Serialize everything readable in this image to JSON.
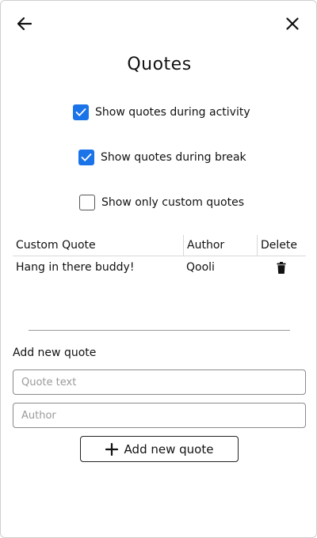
{
  "header": {
    "back_icon": "arrow-left-icon",
    "close_icon": "close-icon",
    "title": "Quotes"
  },
  "options": [
    {
      "label": "Show quotes during activity",
      "checked": true
    },
    {
      "label": "Show quotes during break",
      "checked": true
    },
    {
      "label": "Show only custom quotes",
      "checked": false
    }
  ],
  "table": {
    "columns": [
      "Custom Quote",
      "Author",
      "Delete"
    ],
    "rows": [
      {
        "quote": "Hang in there buddy!",
        "author": "Qooli",
        "delete_icon": "trash-icon"
      }
    ]
  },
  "add": {
    "label": "Add new quote",
    "quote_placeholder": "Quote text",
    "author_placeholder": "Author",
    "button_label": "Add new quote",
    "button_icon": "plus-icon"
  },
  "colors": {
    "accent": "#1a73e8"
  }
}
